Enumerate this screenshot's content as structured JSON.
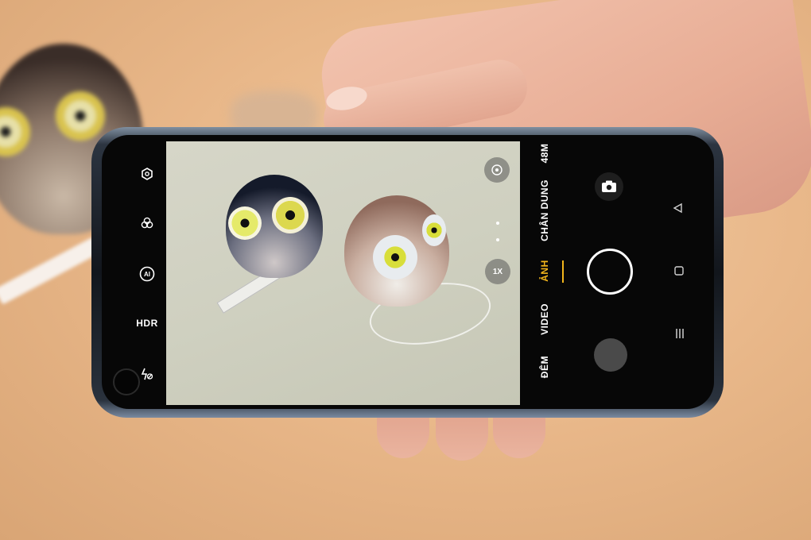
{
  "camera": {
    "left_controls": {
      "settings_icon": "hexagon-settings-icon",
      "filter_icon": "filter-circles-icon",
      "ai_label": "AI",
      "hdr_label": "HDR",
      "flash_icon": "flash-off-icon"
    },
    "viewfinder": {
      "filter_badge_icon": "color-filter-icon",
      "zoom_label": "1X"
    },
    "modes": [
      {
        "label": "48M"
      },
      {
        "label": "CHÂN DUNG"
      },
      {
        "label": "ẢNH",
        "active": true
      },
      {
        "label": "VIDEO"
      },
      {
        "label": "ĐÊM"
      }
    ],
    "shutter_icon": "shutter-button-icon",
    "switch_camera_icon": "camera-switch-icon",
    "gallery_icon": "gallery-thumbnail-icon",
    "nav": {
      "back_icon": "triangle-back-icon",
      "home_icon": "square-home-icon",
      "recents_icon": "recents-lines-icon"
    },
    "colors": {
      "accent": "#f2b51b",
      "screen_bg": "#070707"
    }
  }
}
